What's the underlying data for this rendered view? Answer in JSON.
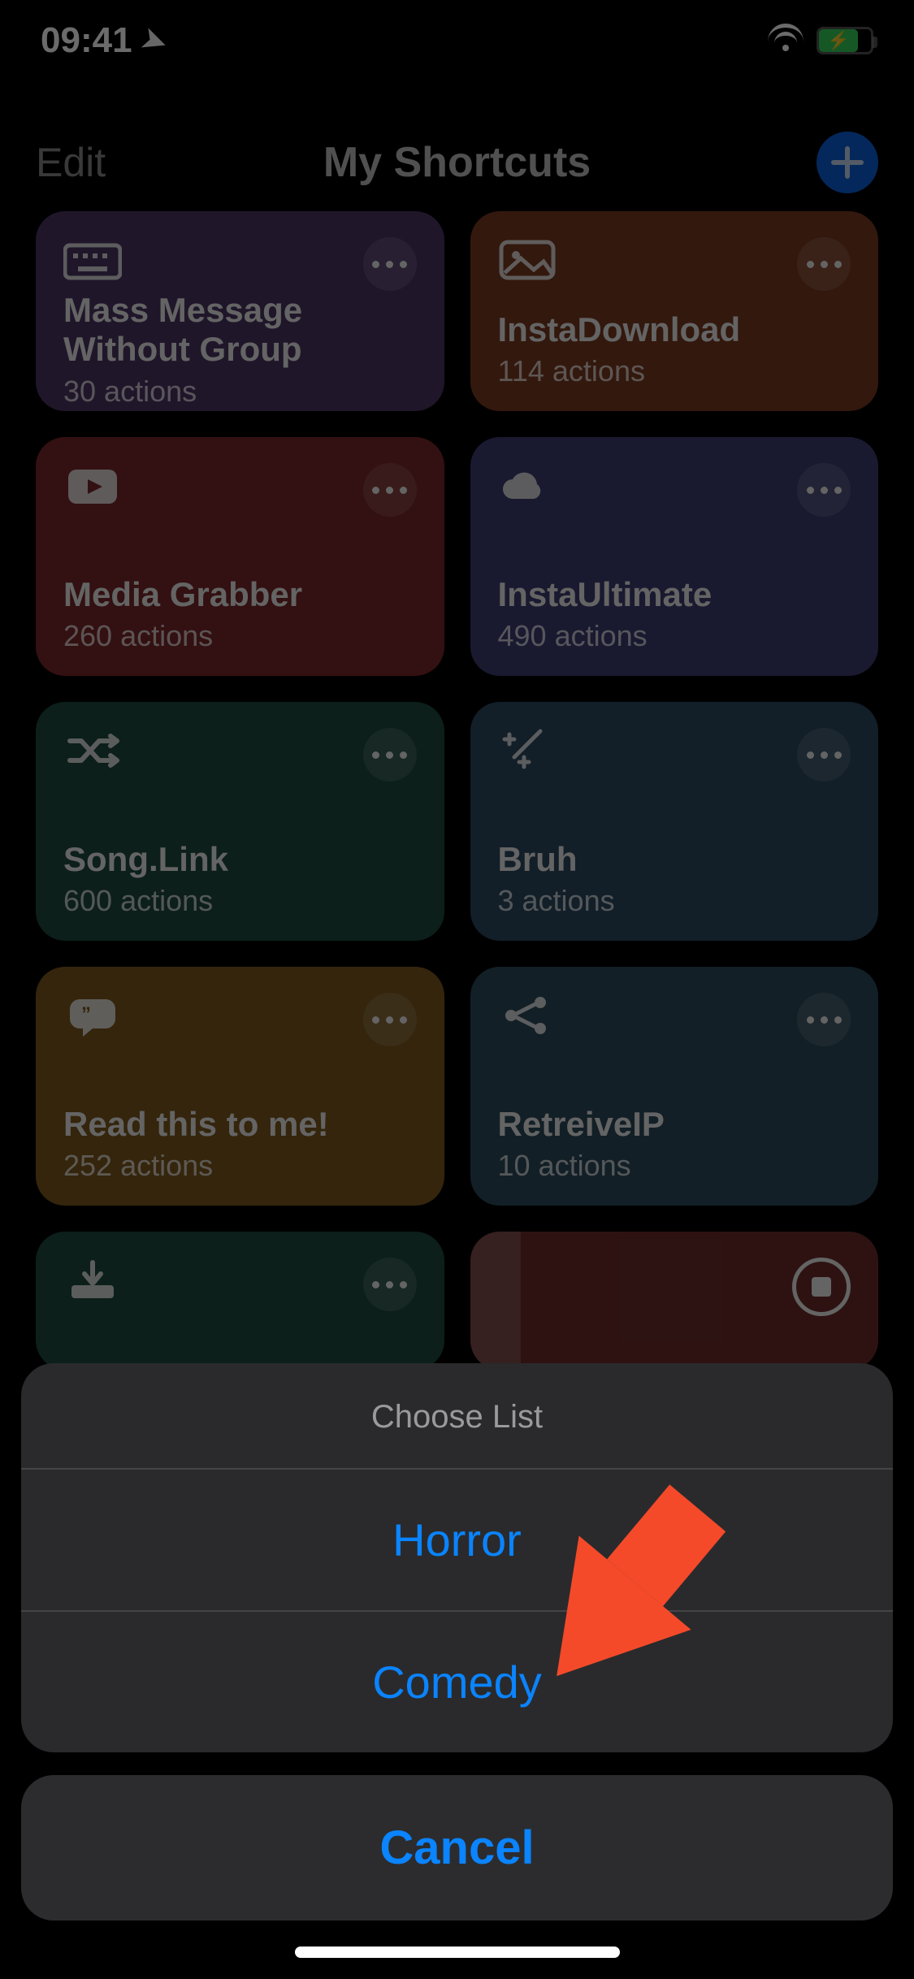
{
  "status": {
    "time": "09:41"
  },
  "nav": {
    "edit": "Edit",
    "title": "My Shortcuts"
  },
  "cards": [
    {
      "name": "Mass Message Without Group",
      "sub": "30 actions"
    },
    {
      "name": "InstaDownload",
      "sub": "114 actions"
    },
    {
      "name": "Media Grabber",
      "sub": "260 actions"
    },
    {
      "name": "InstaUltimate",
      "sub": "490 actions"
    },
    {
      "name": "Song.Link",
      "sub": "600 actions"
    },
    {
      "name": "Bruh",
      "sub": "3 actions"
    },
    {
      "name": "Read this to me!",
      "sub": "252 actions"
    },
    {
      "name": "RetreiveIP",
      "sub": "10 actions"
    }
  ],
  "sheet": {
    "title": "Choose List",
    "options": [
      "Horror",
      "Comedy"
    ],
    "cancel": "Cancel"
  }
}
